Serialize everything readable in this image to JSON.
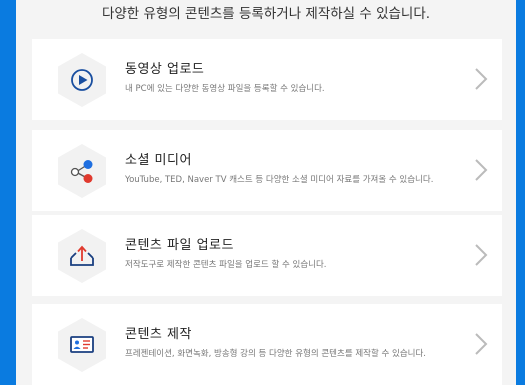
{
  "header": {
    "text": "다양한 유형의 콘텐츠를 등록하거나 제작하실 수 있습니다."
  },
  "options": [
    {
      "title": "동영상 업로드",
      "description": "내 PC에 있는 다양한 동영상 파일을 등록할 수 있습니다.",
      "icon": "play-icon"
    },
    {
      "title": "소셜 미디어",
      "description": "YouTube, TED, Naver TV 캐스트 등 다양한 소셜 미디어 자료를 가져올 수 있습니다.",
      "icon": "share-icon"
    },
    {
      "title": "콘텐츠 파일 업로드",
      "description": "저작도구로 제작한 콘텐츠 파일을 업로드 할 수 있습니다.",
      "icon": "upload-tray-icon"
    },
    {
      "title": "콘텐츠 제작",
      "description": "프레젠테이션, 화면녹화, 방송형 강의 등 다양한 유형의 콘텐츠를 제작할 수 있습니다.",
      "icon": "id-card-icon"
    }
  ],
  "colors": {
    "frame": "#0a7be0",
    "panel": "#f4f4f4",
    "hexagon": "#f2f2f2",
    "play": "#1a4fa0",
    "share_blue": "#1f6fe0",
    "share_red": "#e03a2e",
    "upload_red": "#e03a2e",
    "chevron": "#bbbbbb"
  }
}
